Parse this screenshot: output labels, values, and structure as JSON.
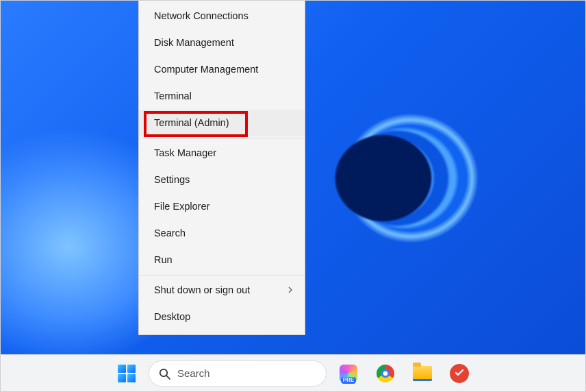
{
  "winx_menu": {
    "items": [
      {
        "label": "Network Connections",
        "has_submenu": false
      },
      {
        "label": "Disk Management",
        "has_submenu": false
      },
      {
        "label": "Computer Management",
        "has_submenu": false
      },
      {
        "label": "Terminal",
        "has_submenu": false
      },
      {
        "label": "Terminal (Admin)",
        "has_submenu": false,
        "hovered": true
      },
      {
        "separator": true
      },
      {
        "label": "Task Manager",
        "has_submenu": false
      },
      {
        "label": "Settings",
        "has_submenu": false
      },
      {
        "label": "File Explorer",
        "has_submenu": false
      },
      {
        "label": "Search",
        "has_submenu": false
      },
      {
        "label": "Run",
        "has_submenu": false
      },
      {
        "separator": true
      },
      {
        "label": "Shut down or sign out",
        "has_submenu": true
      },
      {
        "label": "Desktop",
        "has_submenu": false
      }
    ]
  },
  "annotation": {
    "highlight_target": "Terminal (Admin)",
    "highlight_color": "#e10000",
    "arrow_color": "#e60000"
  },
  "taskbar": {
    "search_placeholder": "Search",
    "pinned_apps": [
      {
        "name": "Copilot Preview",
        "semantic": "copilot-icon"
      },
      {
        "name": "Google Chrome",
        "semantic": "chrome-icon"
      },
      {
        "name": "File Explorer",
        "semantic": "file-explorer-icon"
      },
      {
        "name": "Todoist",
        "semantic": "todoist-icon"
      }
    ]
  }
}
